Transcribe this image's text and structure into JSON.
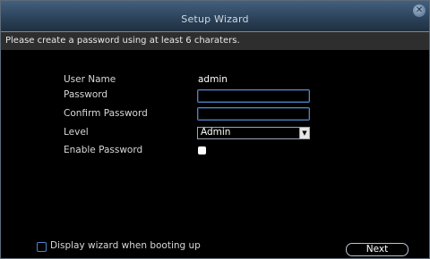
{
  "window": {
    "title": "Setup Wizard",
    "close_symbol": "✕"
  },
  "hint": {
    "text": "Please create a password using at least 6 charaters."
  },
  "form": {
    "username_label": "User Name",
    "username_value": "admin",
    "password_label": "Password",
    "password_value": "",
    "confirm_label": "Confirm Password",
    "confirm_value": "",
    "level_label": "Level",
    "level_value": "Admin",
    "enable_password_label": "Enable Password",
    "enable_password_checked": true
  },
  "footer": {
    "wizard_checkbox_label": "Display wizard when booting up",
    "wizard_checkbox_checked": false,
    "next_label": "Next"
  },
  "icons": {
    "close": "close-icon",
    "dropdown": "chevron-down-icon"
  },
  "colors": {
    "accent": "#4f84c9",
    "titlebar": "#2b4158",
    "background": "#000000"
  }
}
